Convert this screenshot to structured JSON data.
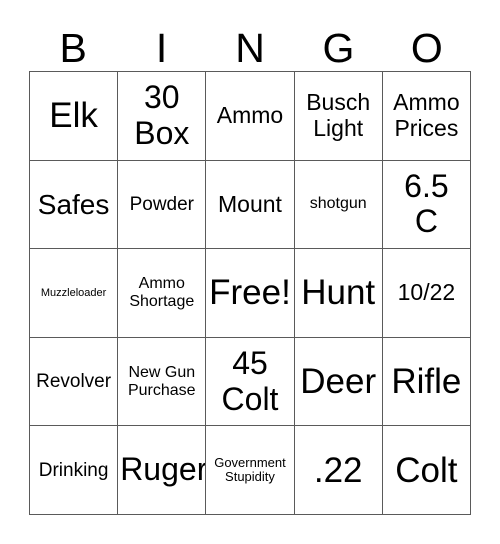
{
  "card": {
    "header_letters": [
      "B",
      "I",
      "N",
      "G",
      "O"
    ],
    "rows": [
      [
        {
          "text": "Elk",
          "size": "fs-xxl"
        },
        {
          "text": "30\nBox",
          "size": "fs-xl"
        },
        {
          "text": "Ammo",
          "size": "fs-md"
        },
        {
          "text": "Busch\nLight",
          "size": "fs-md"
        },
        {
          "text": "Ammo\nPrices",
          "size": "fs-md"
        }
      ],
      [
        {
          "text": "Safes",
          "size": "fs-lg"
        },
        {
          "text": "Powder",
          "size": "fs-sm"
        },
        {
          "text": "Mount",
          "size": "fs-md"
        },
        {
          "text": "shotgun",
          "size": "fs-xs"
        },
        {
          "text": "6.5\nC",
          "size": "fs-xl"
        }
      ],
      [
        {
          "text": "Muzzleloader",
          "size": "fs-tiny"
        },
        {
          "text": "Ammo\nShortage",
          "size": "fs-xs"
        },
        {
          "text": "Free!",
          "size": "fs-xxl"
        },
        {
          "text": "Hunt",
          "size": "fs-xxl"
        },
        {
          "text": "10/22",
          "size": "fs-md"
        }
      ],
      [
        {
          "text": "Revolver",
          "size": "fs-sm"
        },
        {
          "text": "New Gun\nPurchase",
          "size": "fs-xs"
        },
        {
          "text": "45\nColt",
          "size": "fs-xl"
        },
        {
          "text": "Deer",
          "size": "fs-xxl"
        },
        {
          "text": "Rifle",
          "size": "fs-xxl"
        }
      ],
      [
        {
          "text": "Drinking",
          "size": "fs-sm"
        },
        {
          "text": "Ruger",
          "size": "fs-xl"
        },
        {
          "text": "Government\nStupidity",
          "size": "fs-xxs"
        },
        {
          "text": ".22",
          "size": "fs-xxl"
        },
        {
          "text": "Colt",
          "size": "fs-xxl"
        }
      ]
    ]
  },
  "colors": {
    "background": "#ffffff",
    "text": "#000000",
    "grid_line": "#5a5a5a"
  }
}
